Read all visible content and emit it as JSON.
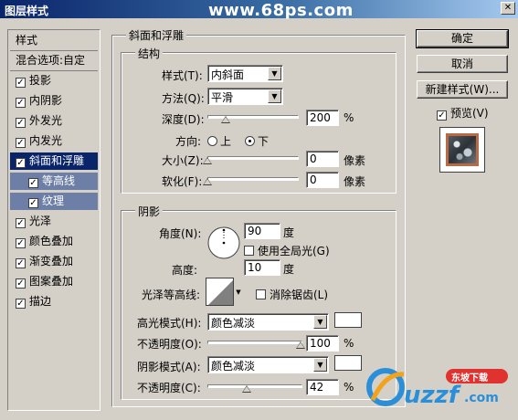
{
  "window": {
    "title": "图层样式",
    "watermark": "www.68ps.com",
    "close_glyph": "✕"
  },
  "style_list": {
    "items": [
      {
        "label": "样式",
        "checkbox": false,
        "state": "header"
      },
      {
        "label": "混合选项:自定",
        "checkbox": false,
        "state": "header"
      },
      {
        "label": "投影",
        "checkbox": true,
        "checked": true,
        "state": "normal"
      },
      {
        "label": "内阴影",
        "checkbox": true,
        "checked": true,
        "state": "normal"
      },
      {
        "label": "外发光",
        "checkbox": true,
        "checked": true,
        "state": "normal"
      },
      {
        "label": "内发光",
        "checkbox": true,
        "checked": true,
        "state": "normal"
      },
      {
        "label": "斜面和浮雕",
        "checkbox": true,
        "checked": true,
        "state": "selected"
      },
      {
        "label": "等高线",
        "checkbox": true,
        "checked": true,
        "state": "sub"
      },
      {
        "label": "纹理",
        "checkbox": true,
        "checked": true,
        "state": "sub"
      },
      {
        "label": "光泽",
        "checkbox": true,
        "checked": true,
        "state": "normal"
      },
      {
        "label": "颜色叠加",
        "checkbox": true,
        "checked": true,
        "state": "normal"
      },
      {
        "label": "渐变叠加",
        "checkbox": true,
        "checked": true,
        "state": "normal"
      },
      {
        "label": "图案叠加",
        "checkbox": true,
        "checked": true,
        "state": "normal"
      },
      {
        "label": "描边",
        "checkbox": true,
        "checked": true,
        "state": "normal"
      }
    ],
    "check_glyph": "✓"
  },
  "bevel": {
    "title": "斜面和浮雕",
    "structure": {
      "title": "结构",
      "style_label": "样式(T):",
      "style_value": "内斜面",
      "technique_label": "方法(Q):",
      "technique_value": "平滑",
      "depth_label": "深度(D):",
      "depth_value": "200",
      "depth_unit": "%",
      "depth_fraction": 0.2,
      "direction_label": "方向:",
      "direction_up": "上",
      "direction_down": "下",
      "direction_selected": "down",
      "size_label": "大小(Z):",
      "size_value": "0",
      "size_unit": "像素",
      "size_fraction": 0,
      "soften_label": "软化(F):",
      "soften_value": "0",
      "soften_unit": "像素",
      "soften_fraction": 0
    },
    "shading": {
      "title": "阴影",
      "angle_label": "角度(N):",
      "angle_value": "90",
      "angle_unit": "度",
      "global_light_label": "使用全局光(G)",
      "global_light_checked": false,
      "altitude_label": "高度:",
      "altitude_value": "10",
      "altitude_unit": "度",
      "gloss_label": "光泽等高线:",
      "antialias_label": "消除锯齿(L)",
      "antialias_checked": false,
      "highlight_mode_label": "高光模式(H):",
      "highlight_mode_value": "颜色减淡",
      "highlight_color": "#ffffff",
      "highlight_opacity_label": "不透明度(O):",
      "highlight_opacity_value": "100",
      "highlight_opacity_fraction": 1.0,
      "shadow_mode_label": "阴影模式(A):",
      "shadow_mode_value": "颜色减淡",
      "shadow_color": "#ffffff",
      "shadow_opacity_label": "不透明度(C):",
      "shadow_opacity_value": "42",
      "shadow_opacity_fraction": 0.42,
      "percent_unit": "%"
    }
  },
  "buttons": {
    "ok": "确定",
    "cancel": "取消",
    "new_style": "新建样式(W)...",
    "preview_label": "预览(V)",
    "preview_checked": true
  },
  "logo": {
    "text": "uzzf",
    "suffix": ".com",
    "badge": "东坡下载"
  }
}
